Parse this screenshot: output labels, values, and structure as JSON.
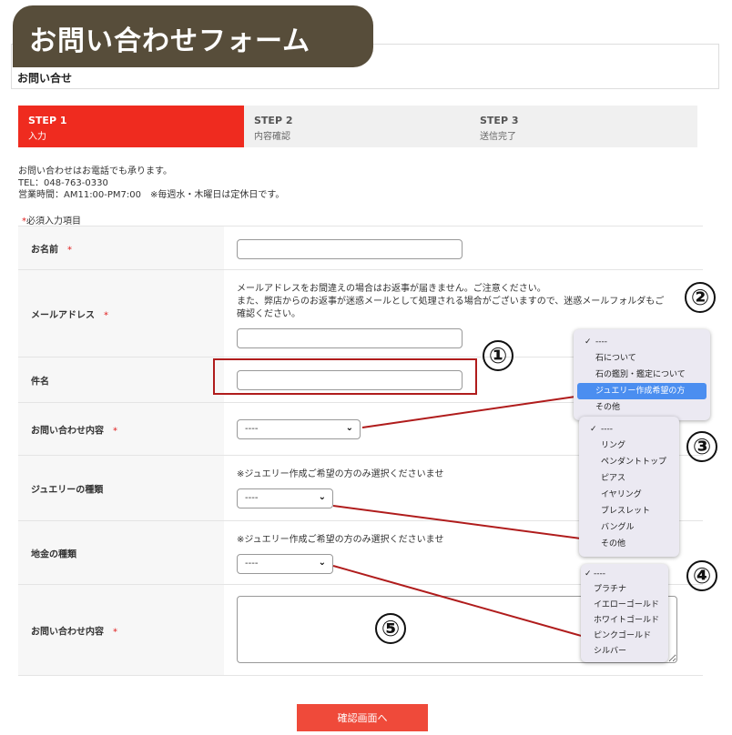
{
  "banner": {
    "title": "お問い合わせフォーム"
  },
  "header": {
    "title": "お問い合せ"
  },
  "steps": [
    {
      "num": "STEP 1",
      "label": "入力"
    },
    {
      "num": "STEP 2",
      "label": "内容確認"
    },
    {
      "num": "STEP 3",
      "label": "送信完了"
    }
  ],
  "intro": {
    "line1": "お問い合わせはお電話でも承ります。",
    "line2": "TEL：048-763-0330",
    "line3": "営業時間：AM11:00-PM7:00　※毎週水・木曜日は定休日です。"
  },
  "required_note": {
    "star": "*",
    "text": "必須入力項目"
  },
  "form": {
    "name_label": "お名前",
    "email_label": "メールアドレス",
    "email_note1": "メールアドレスをお間違えの場合はお返事が届きません。ご注意ください。",
    "email_note2": "また、弊店からのお返事が迷惑メールとして処理される場合がございますので、迷惑メールフォルダもご",
    "email_note3": "確認ください。",
    "subject_label": "件名",
    "inquiry_type_label": "お問い合わせ内容",
    "inquiry_type_value": "----",
    "jewelry_label": "ジュエリーの種類",
    "jewelry_note": "※ジュエリー作成ご希望の方のみ選択くださいませ",
    "jewelry_value": "----",
    "metal_label": "地金の種類",
    "metal_note": "※ジュエリー作成ご希望の方のみ選択くださいませ",
    "metal_value": "----",
    "message_label": "お問い合わせ内容",
    "required_star": "*"
  },
  "dropdowns": {
    "inquiry": [
      "----",
      "石について",
      "石の鑑別・鑑定について",
      "ジュエリー作成希望の方",
      "その他"
    ],
    "jewelry": [
      "----",
      "リング",
      "ペンダントトップ",
      "ピアス",
      "イヤリング",
      "ブレスレット",
      "バングル",
      "その他"
    ],
    "metal": [
      "----",
      "プラチナ",
      "イエローゴールド",
      "ホワイトゴールド",
      "ピンクゴールド",
      "シルバー"
    ],
    "check": "✓"
  },
  "callouts": [
    "①",
    "②",
    "③",
    "④",
    "⑤"
  ],
  "submit": {
    "label": "確認画面へ"
  },
  "colors": {
    "step_active": "#ef2b1f",
    "banner": "#574d3a",
    "annotation": "#b01c1c",
    "submit": "#ef4a3a"
  }
}
